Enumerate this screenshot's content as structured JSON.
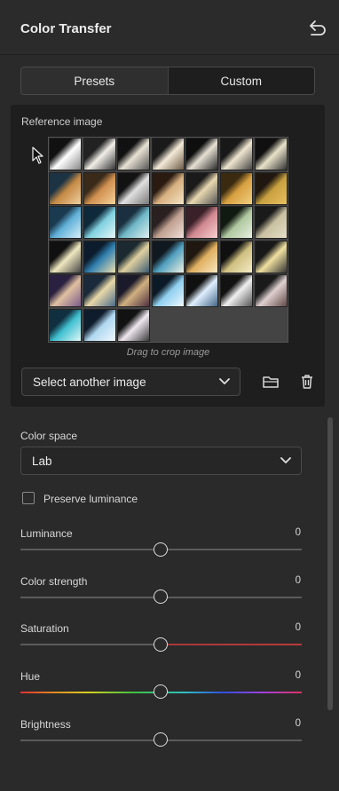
{
  "header": {
    "title": "Color Transfer",
    "reset_icon": "undo-arrow-icon"
  },
  "tabs": [
    {
      "label": "Presets",
      "active": false
    },
    {
      "label": "Custom",
      "active": true
    }
  ],
  "reference": {
    "label": "Reference image",
    "crop_hint": "Drag to crop image",
    "select_label": "Select another image",
    "thumb_count": 38
  },
  "options": {
    "color_space_label": "Color space",
    "color_space_value": "Lab",
    "preserve_luminance_label": "Preserve luminance",
    "preserve_luminance_checked": false
  },
  "sliders": [
    {
      "label": "Luminance",
      "value": "0"
    },
    {
      "label": "Color strength",
      "value": "0"
    },
    {
      "label": "Saturation",
      "value": "0"
    },
    {
      "label": "Hue",
      "value": "0"
    },
    {
      "label": "Brightness",
      "value": "0"
    }
  ],
  "colors": {
    "panel": "#2a2a2a",
    "saturation_right": "#b03a3a",
    "accent_text": "#ececec"
  }
}
